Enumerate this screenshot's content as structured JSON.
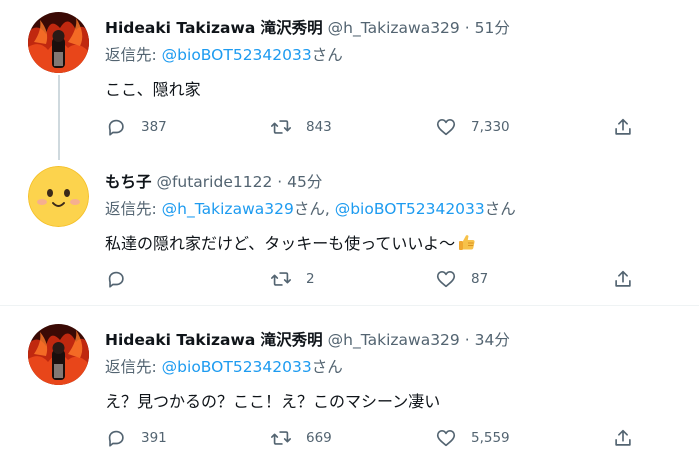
{
  "tweets": [
    {
      "display_name": "Hideaki Takizawa 滝沢秀明",
      "handle": "@h_Takizawa329",
      "separator": "·",
      "time": "51分",
      "reply_prefix": "返信先:",
      "mentions": [
        "@bioBOT52342033"
      ],
      "mention_suffix": "さん",
      "text": "ここ、隠れ家",
      "stats": {
        "replies": "387",
        "retweets": "843",
        "likes": "7,330"
      }
    },
    {
      "display_name": "もち子",
      "handle": "@futaride1122",
      "separator": "·",
      "time": "45分",
      "reply_prefix": "返信先:",
      "mentions": [
        "@h_Takizawa329",
        "@bioBOT52342033"
      ],
      "mention_suffix": "さん",
      "mention_joiner": ",",
      "text": "私達の隠れ家だけど、タッキーも使っていいよ〜",
      "text_emoji": "thumbs-up",
      "stats": {
        "replies": "",
        "retweets": "2",
        "likes": "87"
      }
    },
    {
      "display_name": "Hideaki Takizawa 滝沢秀明",
      "handle": "@h_Takizawa329",
      "separator": "·",
      "time": "34分",
      "reply_prefix": "返信先:",
      "mentions": [
        "@bioBOT52342033"
      ],
      "mention_suffix": "さん",
      "text": "え？見つかるの？ここ！え？このマシーン凄い",
      "stats": {
        "replies": "391",
        "retweets": "669",
        "likes": "5,559"
      }
    }
  ],
  "colors": {
    "text_primary": "#0f1419",
    "text_secondary": "#536471",
    "mention": "#1d9bf0",
    "thread_line": "#cfd9de",
    "emoji_face": "#fcd34d"
  },
  "icons": {
    "reply": "speech-bubble-icon",
    "retweet": "retweet-arrows-icon",
    "like": "heart-outline-icon",
    "share": "share-upload-icon"
  }
}
